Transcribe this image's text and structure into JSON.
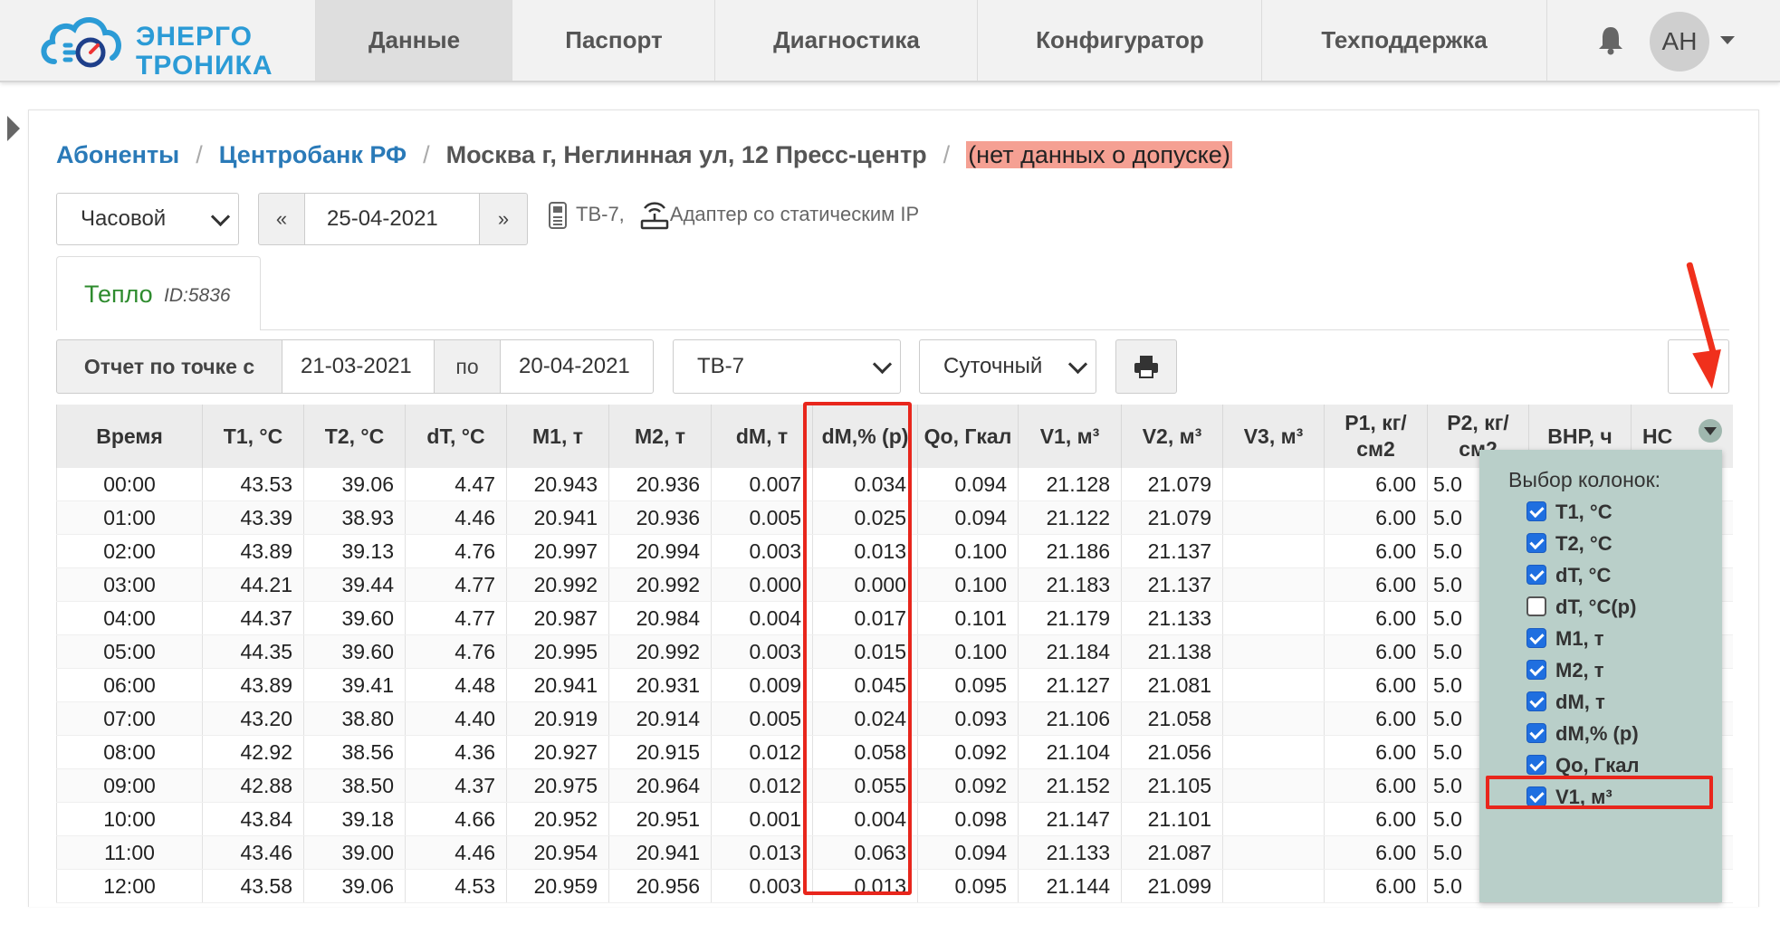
{
  "brand": {
    "line1": "ЭНЕРГО",
    "line2": "ТРОНИКА",
    "color": "#2b9bd6"
  },
  "nav": {
    "items": [
      "Данные",
      "Паспорт",
      "Диагностика",
      "Конфигуратор",
      "Техподдержка"
    ],
    "active": "Данные",
    "avatar": "АН"
  },
  "breadcrumb": {
    "subscribers": "Абоненты",
    "org": "Центробанк РФ",
    "address": "Москва г, Неглинная ул, 12 Пресс-центр",
    "warning": "(нет данных о допуске)"
  },
  "controls": {
    "period": "Часовой",
    "prev": "«",
    "date": "25-04-2021",
    "next": "»",
    "device": "ТВ-7,",
    "adapter": "Адаптер со статическим IP"
  },
  "tab": {
    "name": "Тепло",
    "id": "ID:5836"
  },
  "report": {
    "label": "Отчет по точке с",
    "from": "21-03-2021",
    "to_label": "по",
    "to": "20-04-2021",
    "device": "ТВ-7",
    "type": "Суточный"
  },
  "table": {
    "headers": [
      "Время",
      "T1, °C",
      "T2, °C",
      "dT, °C",
      "M1, т",
      "M2, т",
      "dM, т",
      "dM,% (р)",
      "Qo, Гкал",
      "V1, м³",
      "V2, м³",
      "V3, м³",
      "P1, кг/ см2",
      "P2, кг/ см2",
      "ВНР, ч",
      "НС"
    ],
    "rows": [
      [
        "00:00",
        "43.53",
        "39.06",
        "4.47",
        "20.943",
        "20.936",
        "0.007",
        "0.034",
        "0.094",
        "21.128",
        "21.079",
        "",
        "6.00",
        "5.0"
      ],
      [
        "01:00",
        "43.39",
        "38.93",
        "4.46",
        "20.941",
        "20.936",
        "0.005",
        "0.025",
        "0.094",
        "21.122",
        "21.079",
        "",
        "6.00",
        "5.0"
      ],
      [
        "02:00",
        "43.89",
        "39.13",
        "4.76",
        "20.997",
        "20.994",
        "0.003",
        "0.013",
        "0.100",
        "21.186",
        "21.137",
        "",
        "6.00",
        "5.0"
      ],
      [
        "03:00",
        "44.21",
        "39.44",
        "4.77",
        "20.992",
        "20.992",
        "0.000",
        "0.000",
        "0.100",
        "21.183",
        "21.137",
        "",
        "6.00",
        "5.0"
      ],
      [
        "04:00",
        "44.37",
        "39.60",
        "4.77",
        "20.987",
        "20.984",
        "0.004",
        "0.017",
        "0.101",
        "21.179",
        "21.133",
        "",
        "6.00",
        "5.0"
      ],
      [
        "05:00",
        "44.35",
        "39.60",
        "4.76",
        "20.995",
        "20.992",
        "0.003",
        "0.015",
        "0.100",
        "21.184",
        "21.138",
        "",
        "6.00",
        "5.0"
      ],
      [
        "06:00",
        "43.89",
        "39.41",
        "4.48",
        "20.941",
        "20.931",
        "0.009",
        "0.045",
        "0.095",
        "21.127",
        "21.081",
        "",
        "6.00",
        "5.0"
      ],
      [
        "07:00",
        "43.20",
        "38.80",
        "4.40",
        "20.919",
        "20.914",
        "0.005",
        "0.024",
        "0.093",
        "21.106",
        "21.058",
        "",
        "6.00",
        "5.0"
      ],
      [
        "08:00",
        "42.92",
        "38.56",
        "4.36",
        "20.927",
        "20.915",
        "0.012",
        "0.058",
        "0.092",
        "21.104",
        "21.056",
        "",
        "6.00",
        "5.0"
      ],
      [
        "09:00",
        "42.88",
        "38.50",
        "4.37",
        "20.975",
        "20.964",
        "0.012",
        "0.055",
        "0.092",
        "21.152",
        "21.105",
        "",
        "6.00",
        "5.0"
      ],
      [
        "10:00",
        "43.84",
        "39.18",
        "4.66",
        "20.952",
        "20.951",
        "0.001",
        "0.004",
        "0.098",
        "21.147",
        "21.101",
        "",
        "6.00",
        "5.0"
      ],
      [
        "11:00",
        "43.46",
        "39.00",
        "4.46",
        "20.954",
        "20.941",
        "0.013",
        "0.063",
        "0.094",
        "21.133",
        "21.087",
        "",
        "6.00",
        "5.0"
      ],
      [
        "12:00",
        "43.58",
        "39.06",
        "4.53",
        "20.959",
        "20.956",
        "0.003",
        "0.013",
        "0.095",
        "21.144",
        "21.099",
        "",
        "6.00",
        "5.0"
      ]
    ]
  },
  "chooser": {
    "title": "Выбор колонок:",
    "options": [
      {
        "label": "T1, °C",
        "checked": true
      },
      {
        "label": "T2, °C",
        "checked": true
      },
      {
        "label": "dT, °C",
        "checked": true
      },
      {
        "label": "dT, °C(р)",
        "checked": false
      },
      {
        "label": "M1, т",
        "checked": true
      },
      {
        "label": "M2, т",
        "checked": true
      },
      {
        "label": "dM, т",
        "checked": true
      },
      {
        "label": "dM,% (р)",
        "checked": true
      },
      {
        "label": "Qo, Гкал",
        "checked": true
      },
      {
        "label": "V1, м³",
        "checked": true
      }
    ]
  },
  "colors": {
    "highlight": "#e8261c",
    "link": "#2a7ab8",
    "warning_bg": "#f5a093",
    "chooser_bg": "#b9cfc9"
  }
}
